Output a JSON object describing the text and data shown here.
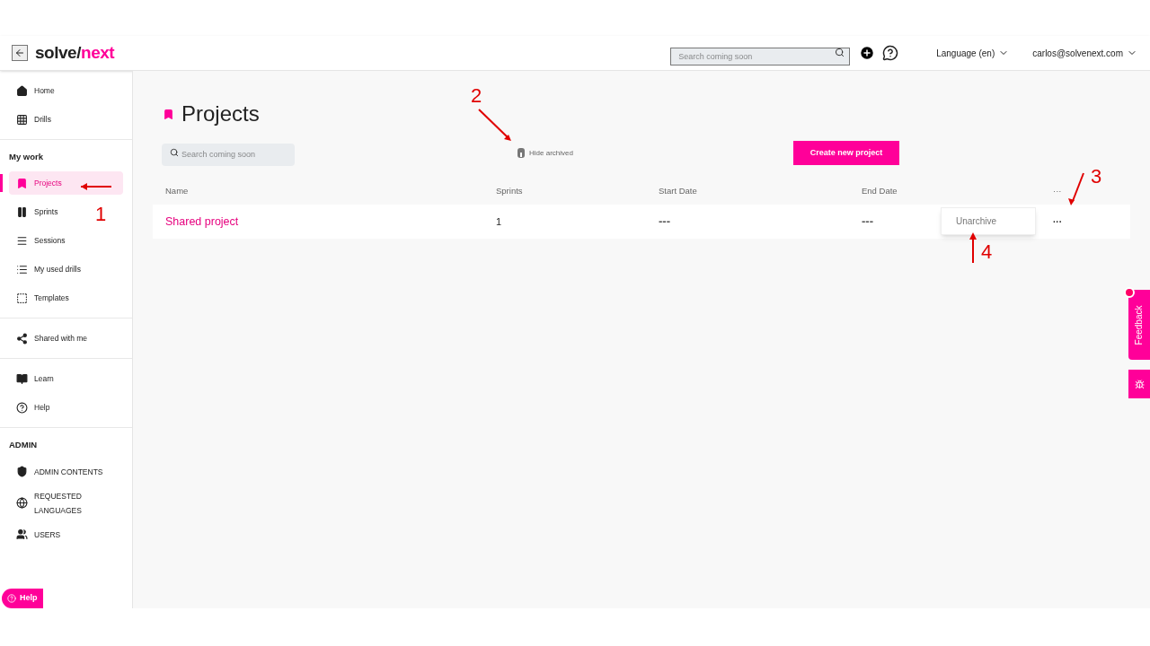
{
  "header": {
    "logo": [
      "solve/",
      "next"
    ],
    "search": {
      "placeholder": "Search coming soon"
    },
    "language": "Language (en)",
    "user": "carlos@solvenext.com"
  },
  "sidebar": {
    "groups": [
      {
        "items": [
          {
            "label": "Home",
            "selected": false
          },
          {
            "label": "Drills",
            "selected": false
          }
        ]
      },
      {
        "heading": "My work",
        "items": [
          {
            "label": "Projects",
            "selected": true
          },
          {
            "label": "Sprints",
            "selected": false
          },
          {
            "label": "Sessions",
            "selected": false
          },
          {
            "label": "My used drills",
            "selected": false
          },
          {
            "label": "Templates",
            "selected": false
          }
        ]
      },
      {
        "items": [
          {
            "label": "Shared with me",
            "selected": false
          }
        ]
      },
      {
        "items": [
          {
            "label": "Learn",
            "selected": false
          },
          {
            "label": "Help",
            "selected": false
          }
        ]
      },
      {
        "heading": "ADMIN",
        "items": [
          {
            "label": "ADMIN CONTENTS",
            "selected": false
          },
          {
            "label": "REQUESTED LANGUAGES",
            "selected": false
          },
          {
            "label": "USERS",
            "selected": false
          }
        ]
      }
    ],
    "help_button": "Help"
  },
  "page": {
    "title": "Projects",
    "search": {
      "placeholder": "Search coming soon"
    },
    "hide_archived": {
      "label": "Hide archived",
      "on": false
    },
    "create_button": "Create new project"
  },
  "table": {
    "columns": [
      "Name",
      "Sprints",
      "Start Date",
      "End Date",
      "···"
    ],
    "rows": [
      {
        "name": "Shared project",
        "sprints": "1",
        "start_date": "---",
        "end_date": "---",
        "menu": "···"
      }
    ]
  },
  "row_menu": {
    "items": [
      "Unarchive"
    ]
  },
  "feedback": {
    "label": "Feedback"
  },
  "annotations": [
    {
      "label": "1"
    },
    {
      "label": "2"
    },
    {
      "label": "3"
    },
    {
      "label": "4"
    }
  ]
}
